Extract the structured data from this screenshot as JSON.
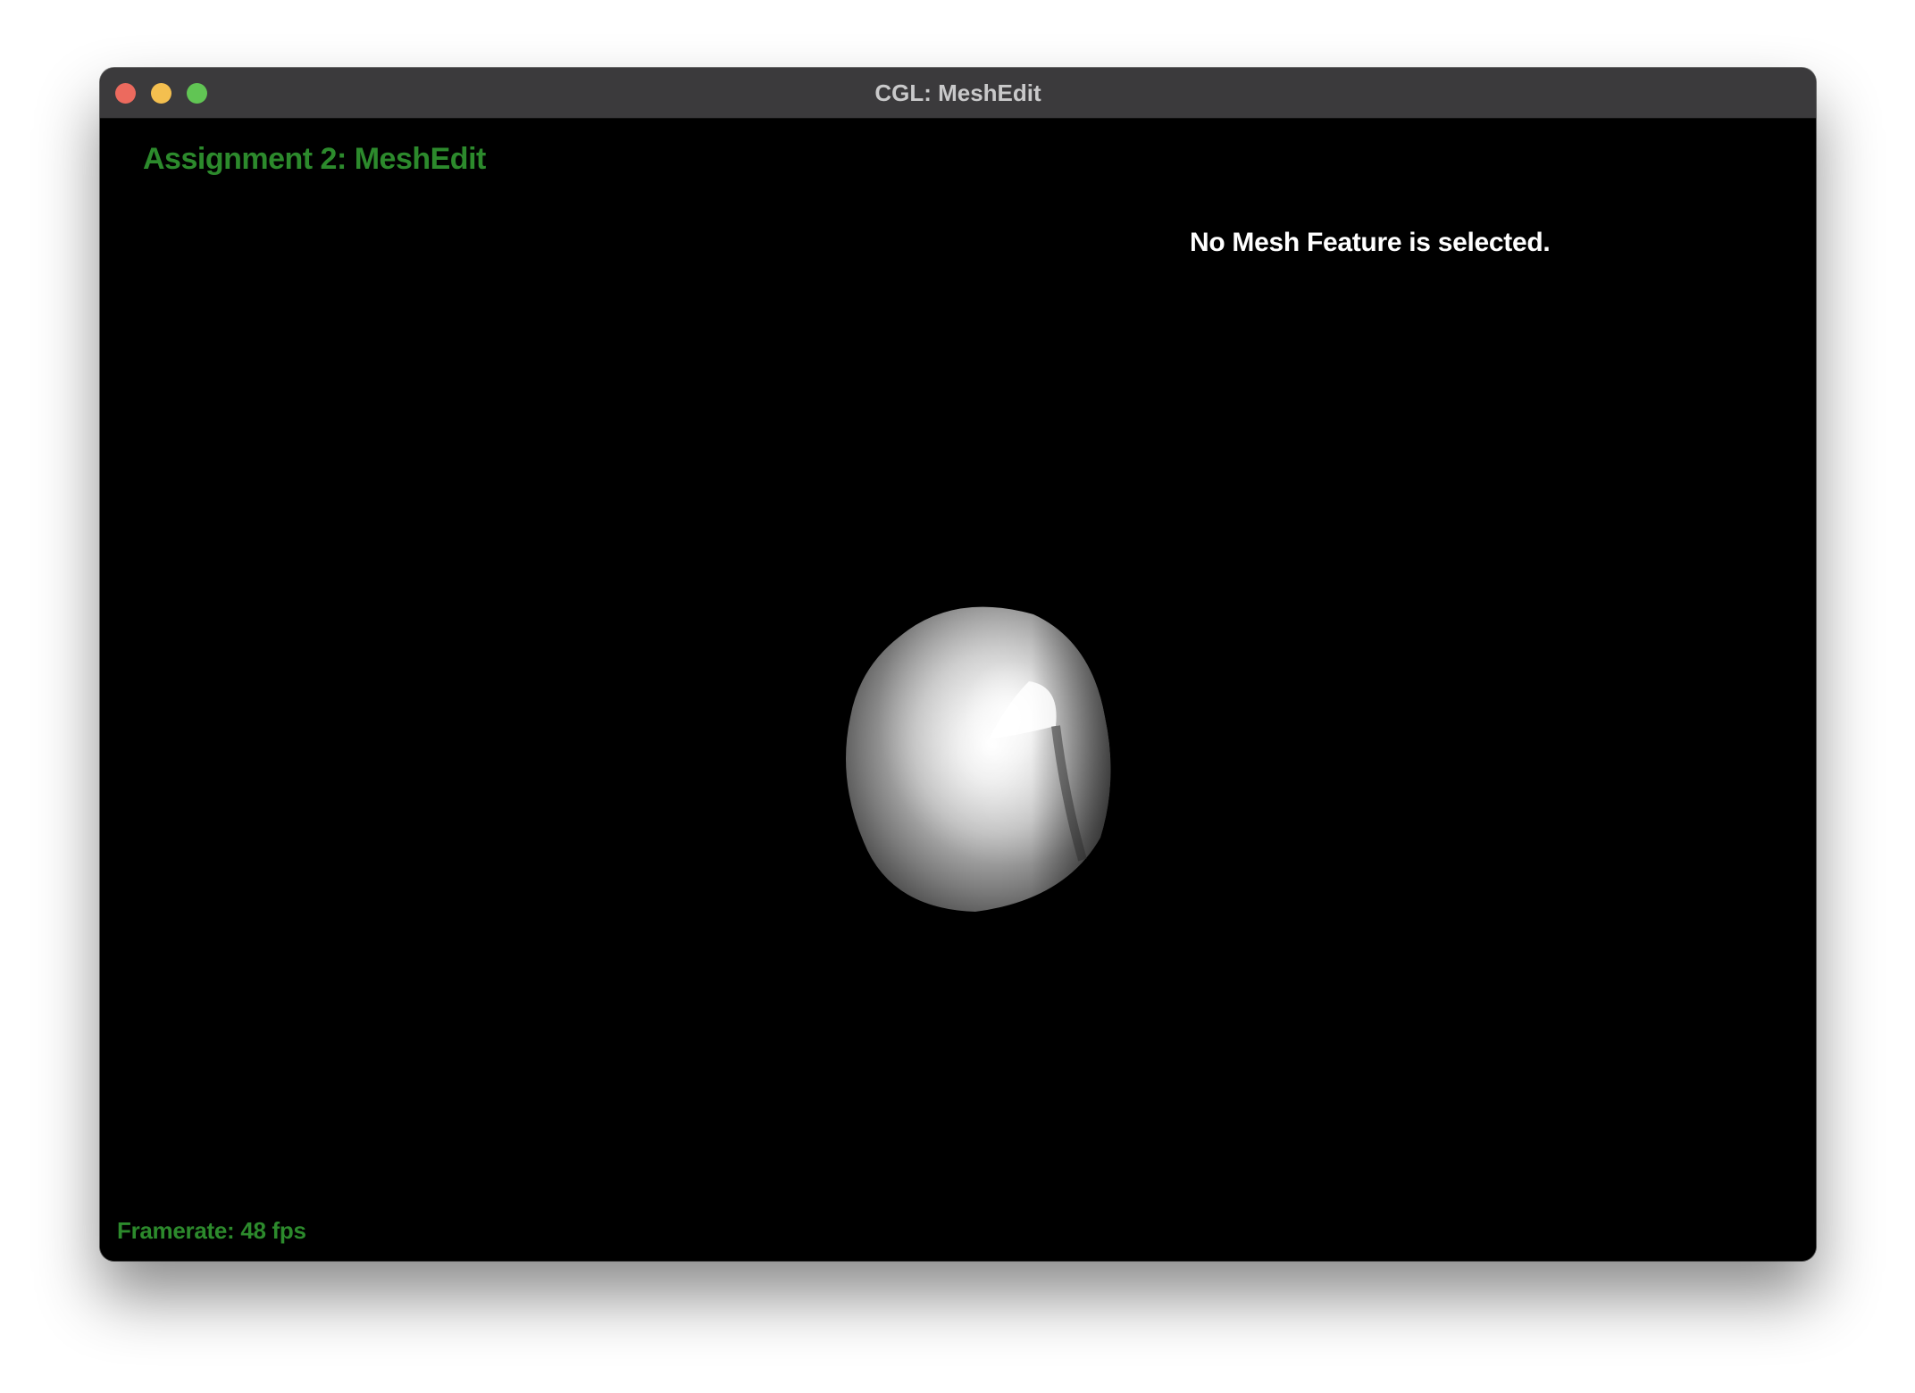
{
  "window": {
    "title": "CGL: MeshEdit",
    "controls": {
      "close_color": "#ec6a5e",
      "minimize_color": "#f4bf4f",
      "maximize_color": "#61c554"
    }
  },
  "viewport": {
    "assignment_label": "Assignment 2: MeshEdit",
    "selection_status": "No Mesh Feature is selected.",
    "framerate_label": "Framerate: 48 fps",
    "background_color": "#000000",
    "label_color": "#2c8a2c"
  }
}
